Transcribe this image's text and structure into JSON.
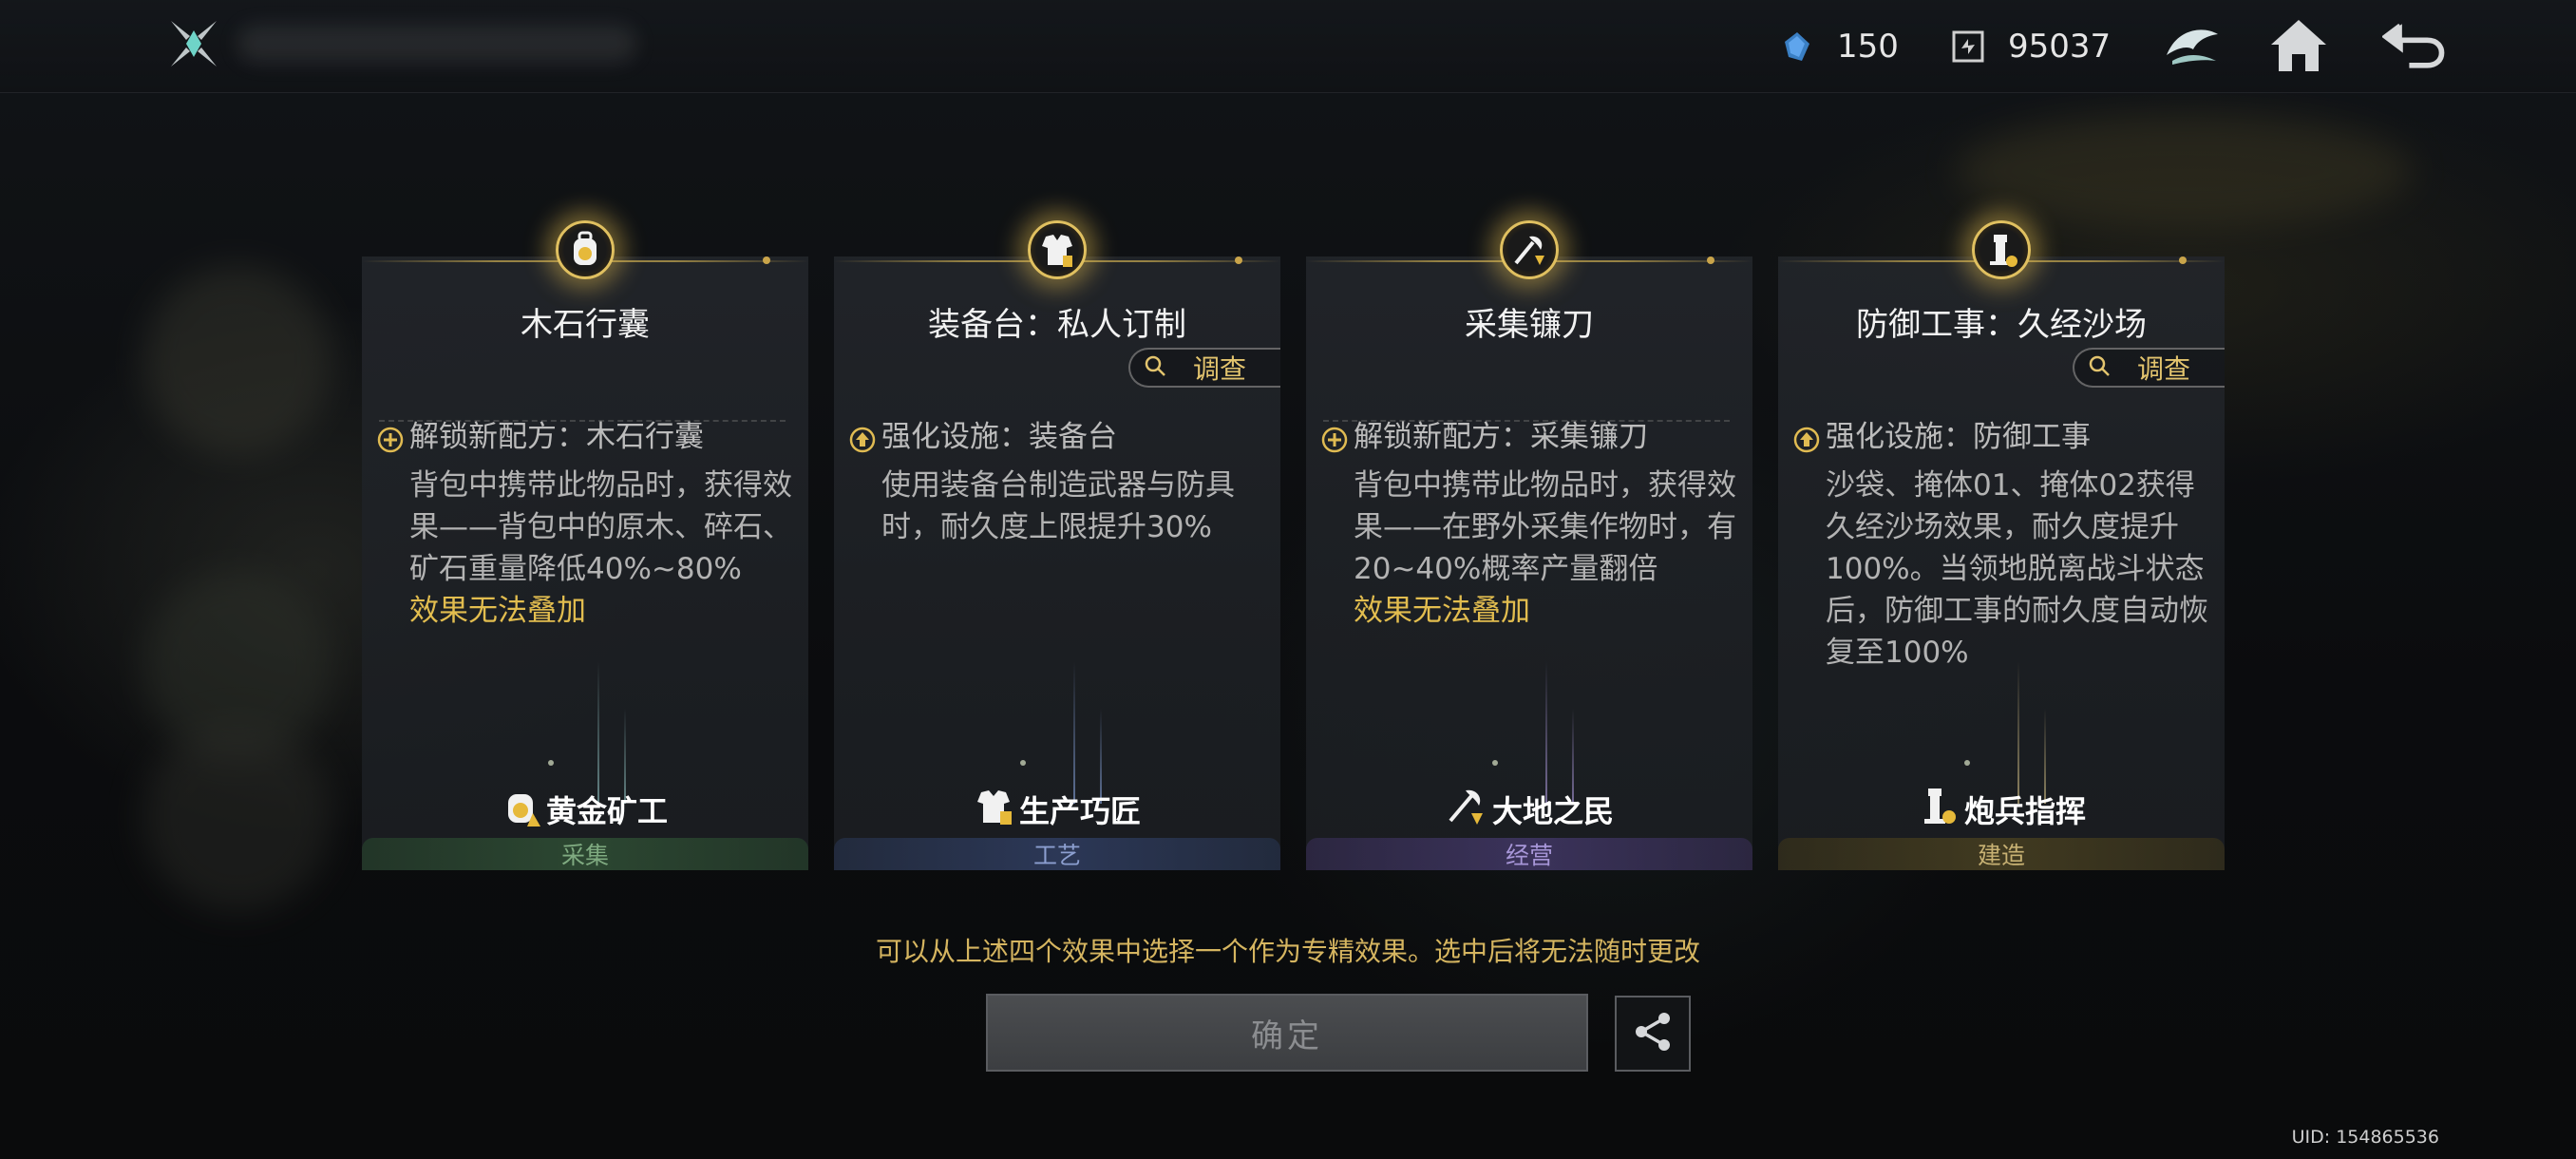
{
  "header": {
    "resources": [
      {
        "icon": "crystal-icon",
        "value": "150"
      },
      {
        "icon": "exchange-coin-icon",
        "value": "95037"
      }
    ],
    "buttons": {
      "emblem": "faction-emblem-icon",
      "home": "home-icon",
      "back": "back-arrow-icon"
    }
  },
  "cards": [
    {
      "title": "木石行囊",
      "has_inspect": false,
      "effect_head": "解锁新配方：木石行囊",
      "effect_desc": "背包中携带此物品时，获得效果——背包中的原木、碎石、矿石重量降低40%~80%",
      "effect_warn": "效果无法叠加",
      "role": "黄金矿工",
      "category": "采集"
    },
    {
      "title": "装备台：私人订制",
      "has_inspect": true,
      "inspect_label": "调查",
      "effect_head": "强化设施：装备台",
      "effect_desc": "使用装备台制造武器与防具时，耐久度上限提升30%",
      "effect_warn": "",
      "role": "生产巧匠",
      "category": "工艺"
    },
    {
      "title": "采集镰刀",
      "has_inspect": false,
      "effect_head": "解锁新配方：采集镰刀",
      "effect_desc": "背包中携带此物品时，获得效果——在野外采集作物时，有20~40%概率产量翻倍",
      "effect_warn": "效果无法叠加",
      "role": "大地之民",
      "category": "经营"
    },
    {
      "title": "防御工事：久经沙场",
      "has_inspect": true,
      "inspect_label": "调查",
      "effect_head": "强化设施：防御工事",
      "effect_desc": "沙袋、掩体01、掩体02获得久经沙场效果，耐久度提升100%。当领地脱离战斗状态后，防御工事的耐久度自动恢复至100%",
      "effect_warn": "",
      "role": "炮兵指挥",
      "category": "建造"
    }
  ],
  "footer": {
    "hint": "可以从上述四个效果中选择一个作为专精效果。选中后将无法随时更改",
    "confirm_label": "确定",
    "uid": "UID: 154865536"
  }
}
